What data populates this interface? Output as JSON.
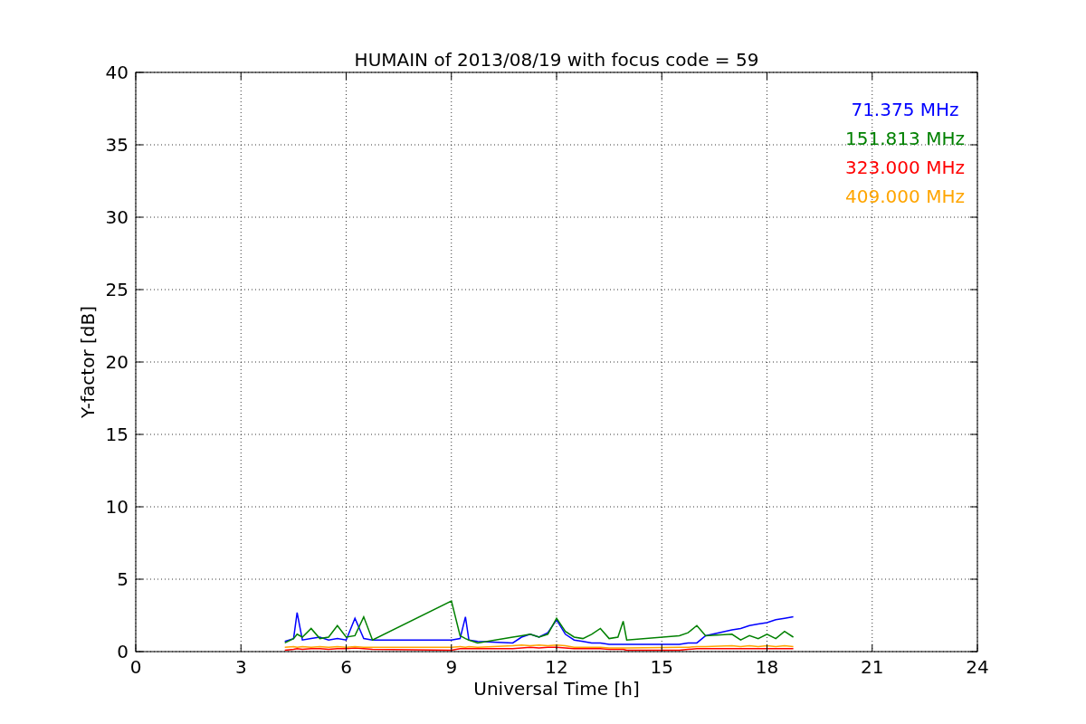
{
  "figure": {
    "chart_data": {
      "type": "line",
      "title": "HUMAIN of 2013/08/19 with focus code = 59",
      "xlabel": "Universal Time [h]",
      "ylabel": "Y-factor [dB]",
      "x": [
        4.25,
        4.5,
        4.6,
        4.75,
        5,
        5.25,
        5.5,
        5.75,
        6,
        6.25,
        6.5,
        6.75,
        9,
        9.25,
        9.4,
        9.5,
        9.75,
        10.75,
        11,
        11.25,
        11.5,
        11.75,
        12,
        12.25,
        12.5,
        12.75,
        13,
        13.25,
        13.5,
        13.75,
        13.9,
        14,
        15.5,
        15.75,
        16,
        16.25,
        17,
        17.25,
        17.5,
        17.75,
        18,
        18.25,
        18.5,
        18.75
      ],
      "series": [
        {
          "name": "71.375 MHz",
          "color": "#0000ff",
          "values": [
            0.7,
            0.9,
            2.7,
            0.8,
            0.9,
            1.0,
            0.8,
            0.9,
            0.8,
            2.3,
            0.9,
            0.8,
            0.8,
            0.9,
            2.4,
            0.8,
            0.7,
            0.6,
            1.0,
            1.2,
            1.0,
            1.3,
            2.2,
            1.2,
            0.8,
            0.7,
            0.6,
            0.6,
            0.5,
            0.5,
            0.5,
            0.5,
            0.5,
            0.6,
            0.6,
            1.1,
            1.5,
            1.6,
            1.8,
            1.9,
            2.0,
            2.2,
            2.3,
            2.4
          ]
        },
        {
          "name": "151.813 MHz",
          "color": "#008000",
          "values": [
            0.6,
            0.9,
            1.2,
            1.0,
            1.6,
            0.9,
            1.0,
            1.8,
            1.0,
            1.1,
            2.4,
            0.8,
            3.5,
            1.1,
            0.9,
            0.8,
            0.6,
            1.0,
            1.1,
            1.2,
            1.0,
            1.2,
            2.3,
            1.4,
            1.0,
            0.9,
            1.2,
            1.6,
            0.9,
            1.0,
            2.1,
            0.8,
            1.1,
            1.3,
            1.8,
            1.1,
            1.2,
            0.8,
            1.1,
            0.9,
            1.2,
            0.9,
            1.4,
            1.0
          ]
        },
        {
          "name": "323.000 MHz",
          "color": "#ff0000",
          "values": [
            0.1,
            0.15,
            0.2,
            0.15,
            0.2,
            0.2,
            0.15,
            0.2,
            0.2,
            0.25,
            0.2,
            0.15,
            0.1,
            0.2,
            0.2,
            0.2,
            0.2,
            0.2,
            0.25,
            0.3,
            0.25,
            0.3,
            0.3,
            0.25,
            0.2,
            0.2,
            0.2,
            0.2,
            0.15,
            0.15,
            0.15,
            0.1,
            0.1,
            0.15,
            0.2,
            0.2,
            0.2,
            0.2,
            0.2,
            0.2,
            0.2,
            0.2,
            0.2,
            0.2
          ]
        },
        {
          "name": "409.000 MHz",
          "color": "#ffa500",
          "values": [
            0.3,
            0.35,
            0.3,
            0.35,
            0.3,
            0.35,
            0.3,
            0.35,
            0.3,
            0.35,
            0.3,
            0.3,
            0.3,
            0.35,
            0.3,
            0.35,
            0.3,
            0.4,
            0.45,
            0.4,
            0.45,
            0.4,
            0.45,
            0.4,
            0.3,
            0.3,
            0.3,
            0.3,
            0.25,
            0.25,
            0.25,
            0.25,
            0.3,
            0.3,
            0.35,
            0.35,
            0.4,
            0.35,
            0.4,
            0.35,
            0.4,
            0.35,
            0.4,
            0.35
          ]
        }
      ],
      "xlim": [
        0,
        24
      ],
      "ylim": [
        0,
        40
      ],
      "xticks": [
        0,
        3,
        6,
        9,
        12,
        15,
        18,
        21,
        24
      ],
      "yticks": [
        0,
        5,
        10,
        15,
        20,
        25,
        30,
        35,
        40
      ],
      "grid": true
    }
  }
}
